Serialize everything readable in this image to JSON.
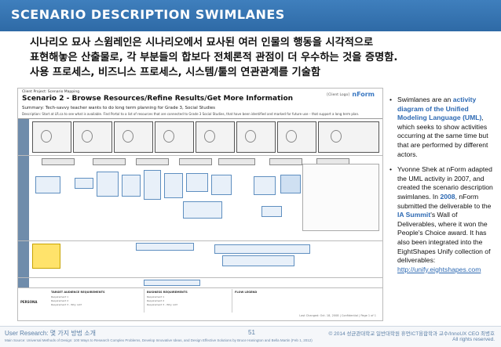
{
  "slide": {
    "title": "SCENARIO DESCRIPTION SWIMLANES",
    "intro_lines": [
      "시나리오 묘사 스윔레인은 시나리오에서 묘사된 여러 인물의 행동을 시각적으로",
      "표현해놓은 산출물로, 각 부분들의 합보다 전체론적 관점이 더 우수하는 것을 증명함.",
      "사용 프로세스, 비즈니스 프로세스, 시스템/툴의 연관관계를 기술함"
    ]
  },
  "document": {
    "client_project": "Client Project: Scenario Mapping",
    "scenario_name": "Scenario 2 - Browse Resources/Refine Results/Get More Information",
    "client_logo": "[Client Logo]",
    "brand_logo": "nForm",
    "summary": "Summary: Tech-savvy teacher wants to do long term planning for Grade 3, Social Studies",
    "description": "Description: Start at LR.ca to see what is available. Find Portal to a list of resources that are connected to Grade 3 Social Studies, that have been identified and marked for future use – that support a long term plan.",
    "footer_text": "Last Changed: Oct. 18, 2008  |  Confidential  |  Page 1 of 1",
    "persona_label": "PERSONA",
    "requirement_sections": [
      {
        "title": "TARGET AUDIENCE REQUIREMENTS",
        "lines": [
          "Requirement 1",
          "Requirement 2",
          "Requirement 3 - Why not?"
        ]
      },
      {
        "title": "BUSINESS REQUIREMENTS",
        "lines": [
          "Requirement 1",
          "Requirement 2",
          "Requirement 3 - Why not?"
        ]
      },
      {
        "title": "FLOW LEGEND",
        "lines": []
      }
    ]
  },
  "sidebar_text": {
    "b1_pre": "Swimlanes are an ",
    "b1_link": "activity diagram of the Unified Modeling Language (UML)",
    "b1_post": ", which seeks to show activities occurring at the same time but that are performed by different actors.",
    "b2_a": "Yvonne Shek at nForm adapted the UML activity in 2007, and created the scenario description swimlanes. In ",
    "b2_year": "2008",
    "b2_b": ", nForm submitted the deliverable to the ",
    "b2_event": "IA Summit",
    "b2_c": "'s Wall of Deliverables, where it won the People's Choice award. It has also been integrated into the EightShapes Unify collection of deliverables: ",
    "b2_url": "http://unify.eightshapes.com"
  },
  "footer": {
    "course": "User Research: 몇 가지 방법 소개",
    "source": "Main Source: Universal Methods of Design: 100 Ways to Research Complex Problems, Develop Innovative Ideas, and Design Effective Solutions by Bruce Hanington and Bella Martin (Feb 1, 2012)",
    "page_number": "51",
    "copyright": "© 2014 성균관대학교 일반대학원 휴먼ICT융합학과 교수/InnoUX CEO 최병호",
    "rights": "All rights reserved."
  },
  "colors": {
    "header_bg": "#2e6aa6",
    "accent_link": "#2e6ab3",
    "lane_label": "#6f8cab",
    "highlight_yellow": "#ffe36b"
  }
}
